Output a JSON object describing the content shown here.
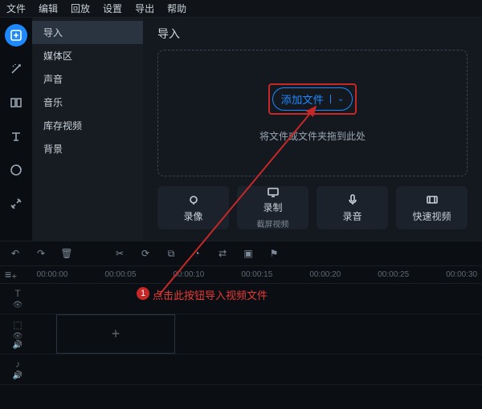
{
  "menu": {
    "file": "文件",
    "edit": "编辑",
    "playback": "回放",
    "settings": "设置",
    "export": "导出",
    "help": "帮助"
  },
  "sidebar": {
    "items": [
      {
        "label": "导入"
      },
      {
        "label": "媒体区"
      },
      {
        "label": "声音"
      },
      {
        "label": "音乐"
      },
      {
        "label": "库存视频"
      },
      {
        "label": "背景"
      }
    ]
  },
  "content": {
    "title": "导入",
    "add_label": "添加文件",
    "drop_hint": "将文件或文件夹拖到此处"
  },
  "cards": [
    {
      "label": "录像",
      "sub": ""
    },
    {
      "label": "录制",
      "sub": "截屏视频"
    },
    {
      "label": "录音",
      "sub": ""
    },
    {
      "label": "快速视频",
      "sub": ""
    }
  ],
  "ruler": [
    "00:00:00",
    "00:00:05",
    "00:00:10",
    "00:00:15",
    "00:00:20",
    "00:00:25",
    "00:00:30"
  ],
  "annotation": {
    "num": "1",
    "text": "点击此按钮导入视频文件"
  }
}
